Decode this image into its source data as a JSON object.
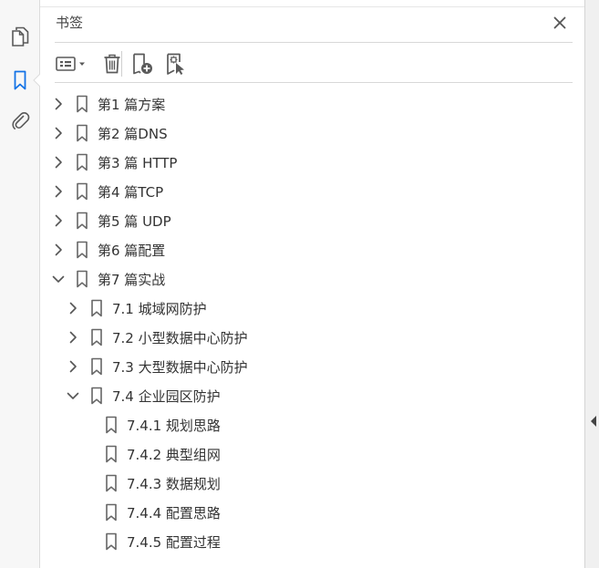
{
  "panel": {
    "title": "书签"
  },
  "colors": {
    "accent": "#1473e6",
    "icon": "#5a5a5a"
  },
  "rail": {
    "items": [
      {
        "icon": "page-thumbnails-icon"
      },
      {
        "icon": "bookmark-icon",
        "active": true
      },
      {
        "icon": "paperclip-icon"
      }
    ]
  },
  "toolbar": {
    "buttons": [
      {
        "icon": "options-menu-icon"
      },
      {
        "icon": "trash-icon"
      },
      {
        "icon": "new-bookmark-icon"
      },
      {
        "icon": "new-bookmark-from-structure-icon"
      }
    ]
  },
  "bookmarks": [
    {
      "label": "第1 篇方案",
      "level": 0,
      "state": "collapsed"
    },
    {
      "label": "第2 篇DNS",
      "level": 0,
      "state": "collapsed"
    },
    {
      "label": "第3 篇 HTTP",
      "level": 0,
      "state": "collapsed"
    },
    {
      "label": "第4 篇TCP",
      "level": 0,
      "state": "collapsed"
    },
    {
      "label": "第5 篇 UDP",
      "level": 0,
      "state": "collapsed"
    },
    {
      "label": "第6 篇配置",
      "level": 0,
      "state": "collapsed"
    },
    {
      "label": "第7 篇实战",
      "level": 0,
      "state": "expanded"
    },
    {
      "label": "7.1 城域网防护",
      "level": 1,
      "state": "collapsed"
    },
    {
      "label": "7.2 小型数据中心防护",
      "level": 1,
      "state": "collapsed"
    },
    {
      "label": "7.3 大型数据中心防护",
      "level": 1,
      "state": "collapsed"
    },
    {
      "label": "7.4 企业园区防护",
      "level": 1,
      "state": "expanded"
    },
    {
      "label": "7.4.1 规划思路",
      "level": 2,
      "state": "leaf"
    },
    {
      "label": "7.4.2 典型组网",
      "level": 2,
      "state": "leaf"
    },
    {
      "label": "7.4.3 数据规划",
      "level": 2,
      "state": "leaf"
    },
    {
      "label": "7.4.4 配置思路",
      "level": 2,
      "state": "leaf"
    },
    {
      "label": "7.4.5 配置过程",
      "level": 2,
      "state": "leaf"
    }
  ]
}
